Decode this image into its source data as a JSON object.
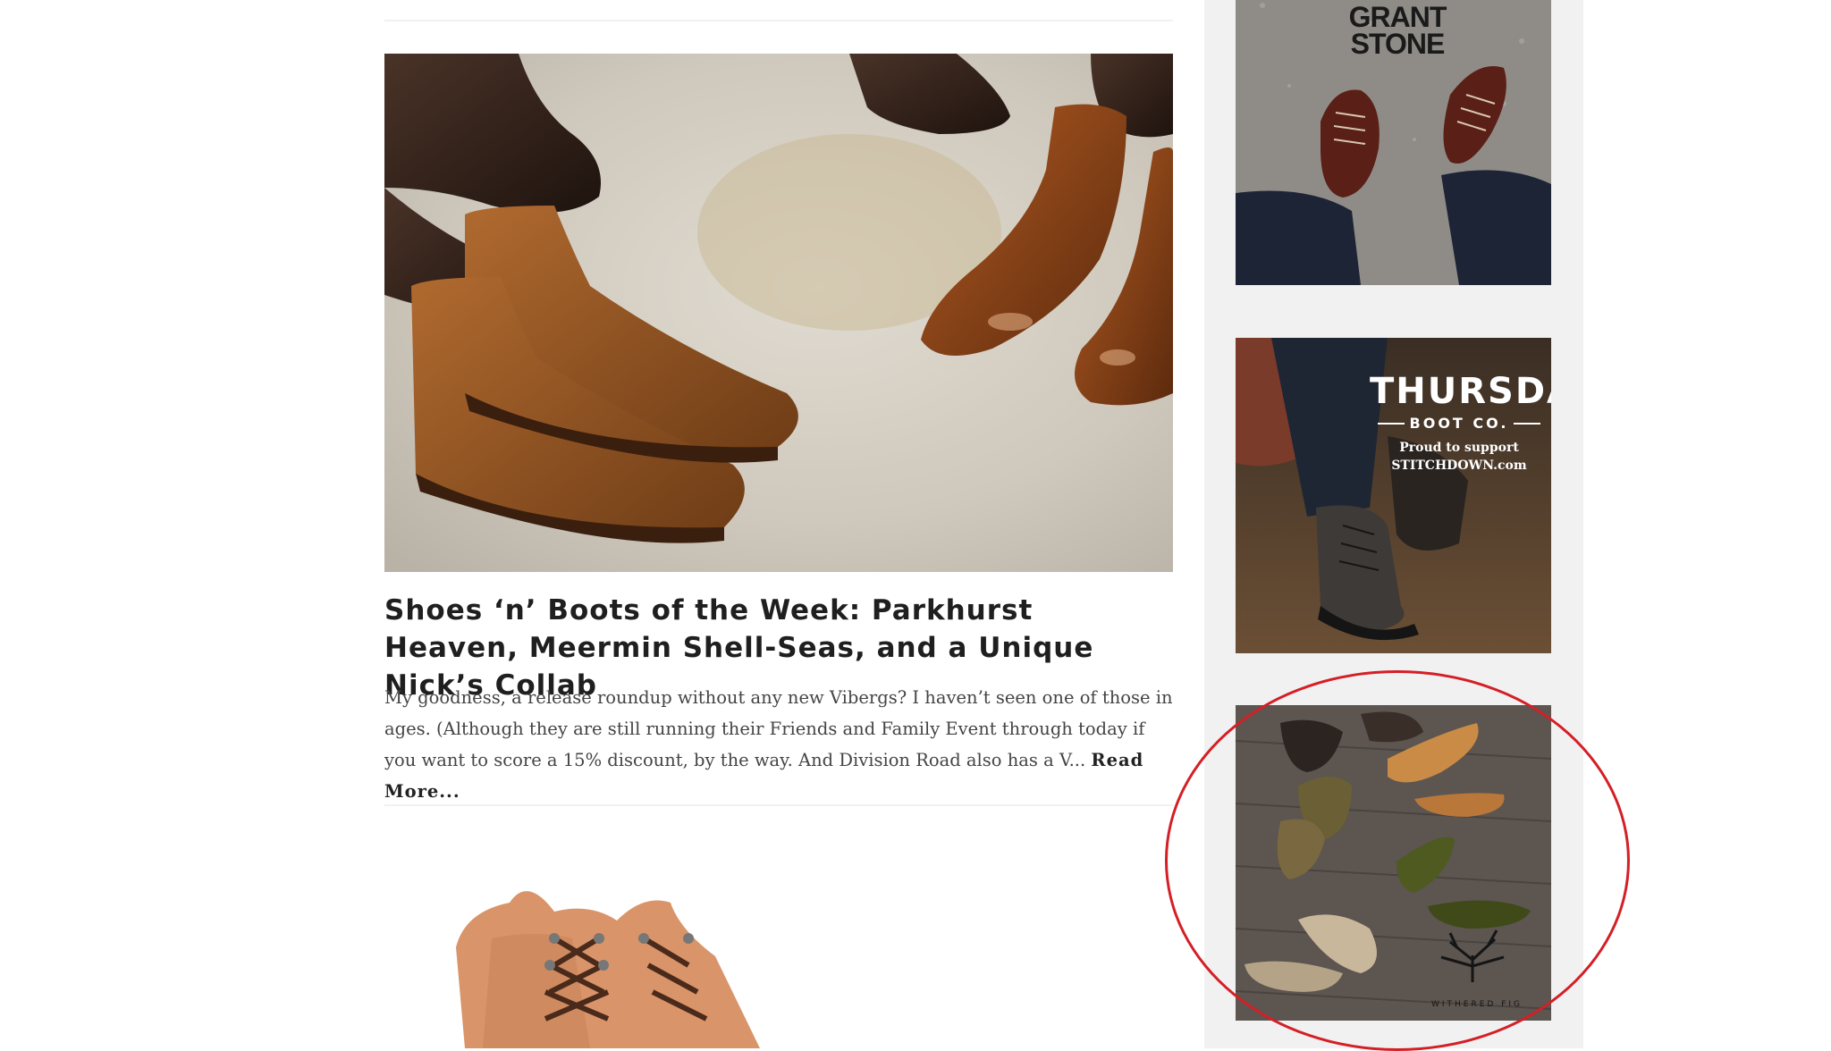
{
  "post": {
    "title": "Shoes ‘n’ Boots of the Week: Parkhurst Heaven, Meermin Shell-Seas, and a Unique Nick’s Collab",
    "excerpt": "My goodness, a release roundup without any new Vibergs? I haven’t seen one of those in ages. (Although they are still running their Friends and Family Event through today if you want to score a 15% discount, by the way. And Division Road also has a V...",
    "read_more": "Read More..."
  },
  "sidebar": {
    "ads": [
      {
        "name": "grant-stone",
        "logo_line1": "GRANT",
        "logo_line2": "STONE"
      },
      {
        "name": "thursday-boot",
        "brand": "THURSDAY",
        "sub": "BOOT CO.",
        "tag1": "Proud to support",
        "tag2": "STITCHDOWN.com"
      },
      {
        "name": "withered-fig",
        "brand": "WITHERED FIG"
      }
    ]
  },
  "colors": {
    "highlight": "#d41f26",
    "sidebar_bg": "#f1f1f1",
    "title": "#1f1f1f",
    "text": "#444444"
  }
}
